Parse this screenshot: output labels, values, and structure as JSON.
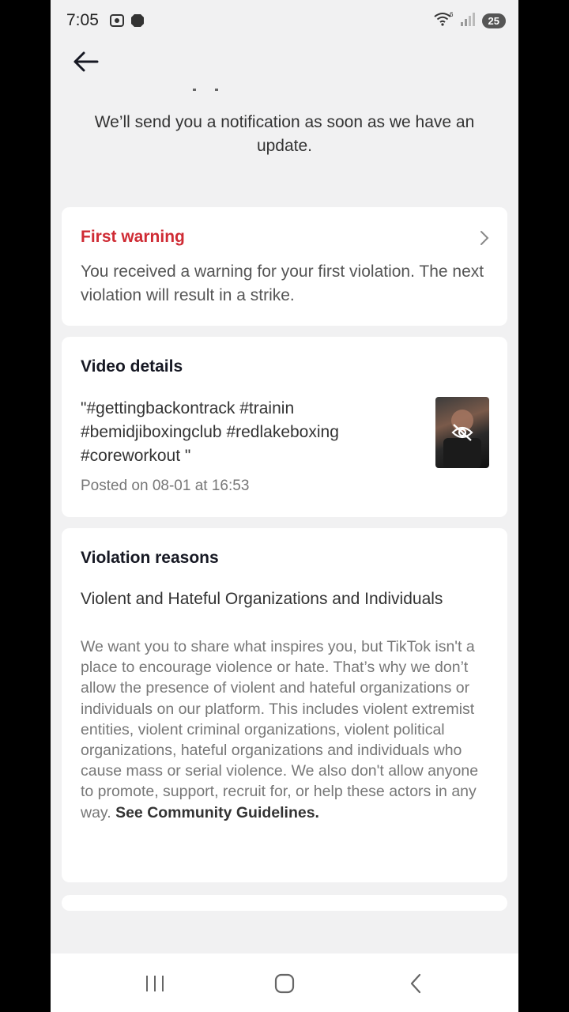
{
  "status_bar": {
    "time": "7:05",
    "battery": "25",
    "icons": [
      "screenshot-icon",
      "recording-icon",
      "wifi-icon",
      "signal-icon",
      "battery-icon"
    ]
  },
  "header": {
    "back_icon": "arrow-left-icon"
  },
  "notice": {
    "text": "We’ll send you a notification as soon as we have an update."
  },
  "warning_card": {
    "title": "First warning",
    "body": "You received a warning for your first violation. The next violation will result in a strike.",
    "chevron_icon": "chevron-right-icon"
  },
  "video_card": {
    "title": "Video details",
    "caption": "\"#gettingbackontrack #trainin #bemidjiboxingclub #redlakeboxing #coreworkout \"",
    "posted": "Posted on 08-01 at 16:53",
    "thumb_icon": "eye-off-icon"
  },
  "violation_card": {
    "title": "Violation reasons",
    "subtitle": "Violent and Hateful Organizations and Individuals",
    "body": "We want you to share what inspires you, but TikTok isn't a place to encourage violence or hate. That’s why we don’t allow the presence of violent and hateful organizations or individuals on our platform. This includes violent extremist entities, violent criminal organizations, violent political organizations, hateful organizations and individuals who cause mass or serial violence. We also don't allow anyone to promote, support, recruit for, or help these actors in any way. ",
    "link": "See Community Guidelines."
  },
  "nav_bar": {
    "icons": [
      "recent-apps-icon",
      "home-icon",
      "back-icon"
    ]
  },
  "colors": {
    "warning_red": "#cf2b34",
    "background": "#f1f1f2",
    "card": "#ffffff"
  }
}
